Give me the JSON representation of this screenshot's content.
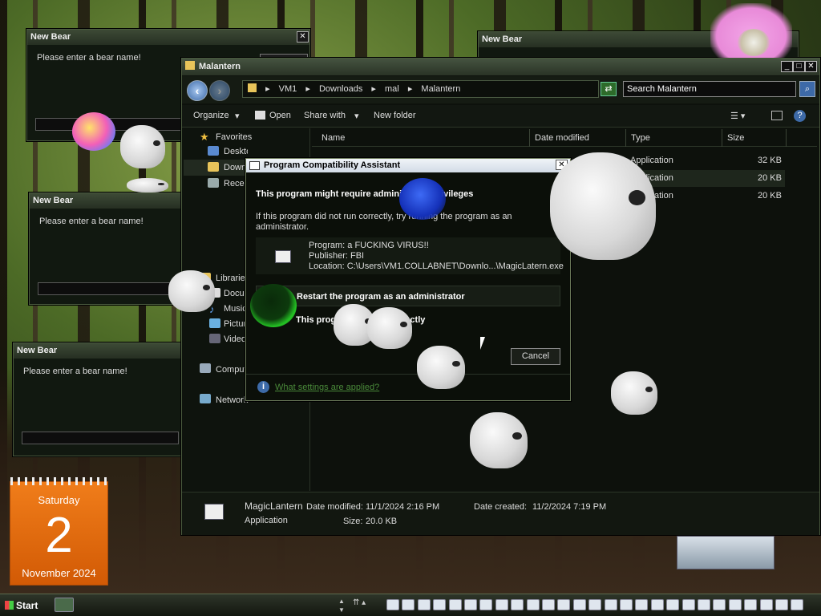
{
  "bear_dialogs": [
    {
      "title": "New Bear",
      "prompt": "Please enter a bear name!"
    },
    {
      "title": "New Bear",
      "prompt": ""
    },
    {
      "title": "New Bear",
      "prompt": "Please enter a bear name!"
    },
    {
      "title": "New Bear",
      "prompt": "Please enter a bear name!"
    }
  ],
  "explorer": {
    "title": "Malantern",
    "breadcrumb": [
      "VM1",
      "Downloads",
      "mal",
      "Malantern"
    ],
    "search_placeholder": "Search Malantern",
    "toolbar": {
      "organize": "Organize",
      "open": "Open",
      "share": "Share with",
      "new_folder": "New folder"
    },
    "nav": {
      "favorites": "Favorites",
      "desktop": "Desktop",
      "downloads": "Downloads",
      "recent": "Recent Places",
      "libraries": "Libraries",
      "documents": "Documents",
      "music": "Music",
      "pictures": "Pictures",
      "videos": "Videos",
      "computer": "Computer",
      "network": "Network"
    },
    "columns": {
      "name": "Name",
      "date": "Date modified",
      "type": "Type",
      "size": "Size"
    },
    "files": [
      {
        "type": "Application",
        "size": "32 KB"
      },
      {
        "type": "Application",
        "size": "20 KB"
      },
      {
        "type": "Application",
        "size": "20 KB"
      }
    ],
    "details": {
      "name": "MagicLantern",
      "kind": "Application",
      "modified_label": "Date modified:",
      "modified": "11/1/2024 2:16 PM",
      "size_label": "Size:",
      "size": "20.0 KB",
      "created_label": "Date created:",
      "created": "11/2/2024 7:19 PM"
    }
  },
  "pca": {
    "title": "Program Compatibility Assistant",
    "heading": "This program might require administrator privileges",
    "desc": "If this program did not run correctly, try running the program as an administrator.",
    "program": "Program: a FUCKING VIRUS!!",
    "publisher": "Publisher: FBI",
    "location": "Location: C:\\Users\\VM1.COLLABNET\\Downlo...\\MagicLatern.exe",
    "option1": "Restart the program as an administrator",
    "option2": "This program worked correctly",
    "cancel": "Cancel",
    "link": "What settings are applied?"
  },
  "calendar": {
    "day": "Saturday",
    "date": "2",
    "month_year": "November 2024"
  },
  "taskbar": {
    "start": "Start"
  },
  "colors": {
    "calendar_orange": "#e8700f",
    "link_green": "#4a8a3a",
    "accent_blue": "#3d6aa8"
  }
}
